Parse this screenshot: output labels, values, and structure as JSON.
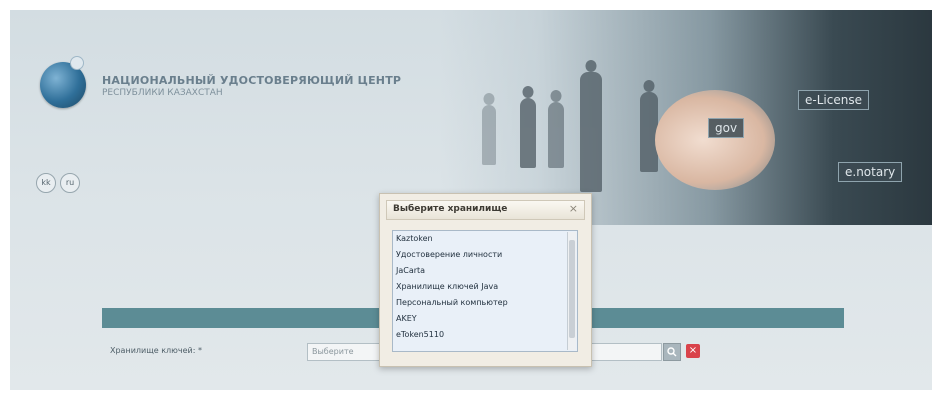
{
  "header": {
    "org_title": "НАЦИОНАЛЬНЫЙ УДОСТОВЕРЯЮЩИЙ ЦЕНТР",
    "org_subtitle": "РЕСПУБЛИКИ КАЗАХСТАН",
    "lang_buttons": [
      "kk",
      "ru"
    ]
  },
  "banner": {
    "tiles": [
      "e-License",
      "e.notary",
      "gov"
    ]
  },
  "form": {
    "store_label": "Хранилище ключей: *",
    "store_placeholder": "Выберите",
    "clear_label": "×"
  },
  "dialog": {
    "title": "Выберите хранилище",
    "close_label": "×",
    "items": [
      "Kaztoken",
      "Удостоверение личности",
      "JaCarta",
      "Хранилище ключей Java",
      "Персональный компьютер",
      "AKEY",
      "eToken5110"
    ]
  },
  "colors": {
    "form_header": "#5c8c95",
    "clear_button": "#d9434b",
    "listbox_bg": "#e9f0f8"
  }
}
